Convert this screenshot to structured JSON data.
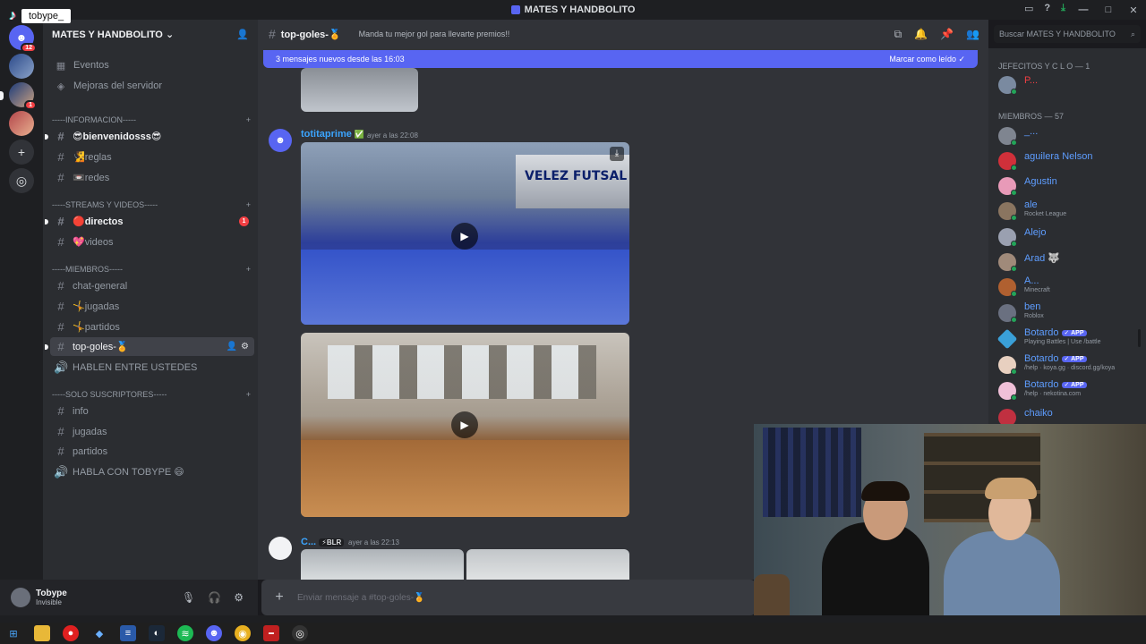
{
  "window": {
    "title": "MATES Y HANDBOLITO"
  },
  "overlay": {
    "tiktok_icon": "tiktok-logo",
    "username": "tobype_"
  },
  "rail": {
    "home_badge": "12",
    "server_badge": "1"
  },
  "server": {
    "name": "MATES Y HANDBOLITO",
    "nav": [
      {
        "label": "Eventos",
        "icon": "calendar-icon"
      },
      {
        "label": "Mejoras del servidor",
        "icon": "boost-icon"
      }
    ],
    "categories": [
      {
        "label": "-----INFORMACION-----"
      },
      {
        "label": "-----STREAMS Y VIDEOS-----"
      },
      {
        "label": "-----MIEMBROS-----"
      },
      {
        "label": "-----SOLO SUSCRIPTORES-----"
      }
    ],
    "channels": [
      {
        "label": "😎bienvenidosss😎"
      },
      {
        "label": "🧏reglas"
      },
      {
        "label": "📼redes"
      },
      {
        "label": "🔴directos",
        "badge": "1"
      },
      {
        "label": "💖videos"
      },
      {
        "label": "chat-general"
      },
      {
        "label": "🤸jugadas"
      },
      {
        "label": "🤸partidos"
      },
      {
        "label": "top-goles-🏅"
      },
      {
        "label": "HABLEN ENTRE USTEDES"
      },
      {
        "label": "info"
      },
      {
        "label": "jugadas"
      },
      {
        "label": "partidos"
      },
      {
        "label": "HABLA CON TOBYPE 😄"
      }
    ]
  },
  "user": {
    "name": "Tobype",
    "status": "Invisible"
  },
  "channel_header": {
    "name": "top-goles-🏅",
    "topic": "Manda tu mejor gol para llevarte premios!!"
  },
  "search": {
    "placeholder": "Buscar MATES Y HANDBOLITO"
  },
  "new_messages_bar": {
    "text": "3 mensajes nuevos desde las 16:03",
    "action": "Marcar como leído"
  },
  "messages": [
    {
      "author": "totitaprime",
      "badge": "✅",
      "time": "ayer a las 22:08"
    },
    {
      "author": "C...",
      "tag": "BLR",
      "time": "ayer a las 22:13"
    }
  ],
  "composer": {
    "placeholder": "Enviar mensaje a #top-goles-🏅"
  },
  "members": {
    "categories": [
      {
        "label": "JEFECITOS Y C L O — 1"
      },
      {
        "label": "MIEMBROS — 57"
      }
    ],
    "list": [
      {
        "name": "P...",
        "sub": "",
        "color": "#f23f43"
      },
      {
        "name": "_...",
        "sub": "",
        "color": "#5e9dff"
      },
      {
        "name": "aguilera Nelson",
        "sub": "",
        "color": "#5e9dff"
      },
      {
        "name": "Agustin",
        "sub": "",
        "color": "#5e9dff"
      },
      {
        "name": "ale",
        "sub": "Rocket League",
        "color": "#5e9dff"
      },
      {
        "name": "Alejo",
        "sub": "",
        "color": "#5e9dff"
      },
      {
        "name": "Arad 🐺",
        "sub": "",
        "color": "#5e9dff"
      },
      {
        "name": "A...",
        "sub": "Minecraft",
        "color": "#5e9dff"
      },
      {
        "name": "ben",
        "sub": "Roblox",
        "color": "#5e9dff"
      },
      {
        "name": "Botardo",
        "app": "APP",
        "sub": "Playing Battles | Use /battle",
        "color": "#5e9dff"
      },
      {
        "name": "Botardo",
        "app": "APP",
        "sub": "/help · koya.gg · discord.gg/koya",
        "color": "#5e9dff"
      },
      {
        "name": "Botardo",
        "app": "APP",
        "sub": "/help · nekotina.com",
        "color": "#5e9dff"
      },
      {
        "name": "chaiko",
        "sub": "",
        "color": "#5e9dff"
      }
    ]
  },
  "video": {
    "court_text": "VELEZ FUTSAL"
  },
  "colors": {
    "accent": "#5865f2",
    "online": "#23a559",
    "danger": "#f23f43"
  }
}
